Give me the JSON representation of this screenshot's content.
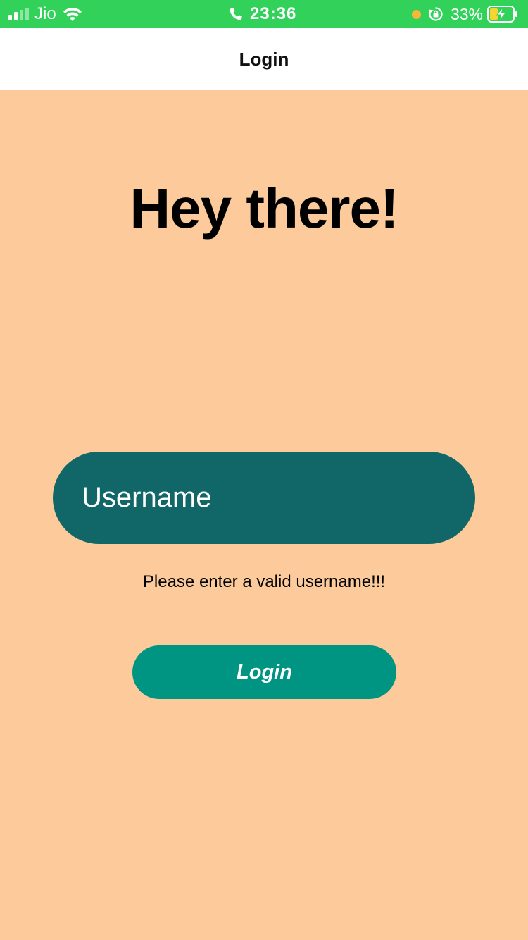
{
  "status_bar": {
    "carrier": "Jio",
    "time": "23:36",
    "battery_percent": "33%",
    "signal_bars_active": 2,
    "signal_bars_total": 4,
    "background_color": "#32d15a",
    "icons": [
      "signal-icon",
      "wifi-icon",
      "phone-call-icon",
      "privacy-dot-icon",
      "rotation-lock-icon",
      "battery-charging-icon"
    ]
  },
  "nav_bar": {
    "title": "Login"
  },
  "main": {
    "greeting": "Hey there!",
    "username_input": {
      "placeholder": "Username",
      "value": ""
    },
    "error_message": "Please enter a valid username!!!",
    "login_button_label": "Login"
  },
  "colors": {
    "background": "#fdcb9b",
    "input_background": "#116767",
    "button_background": "#009482",
    "text_primary": "#000000"
  }
}
